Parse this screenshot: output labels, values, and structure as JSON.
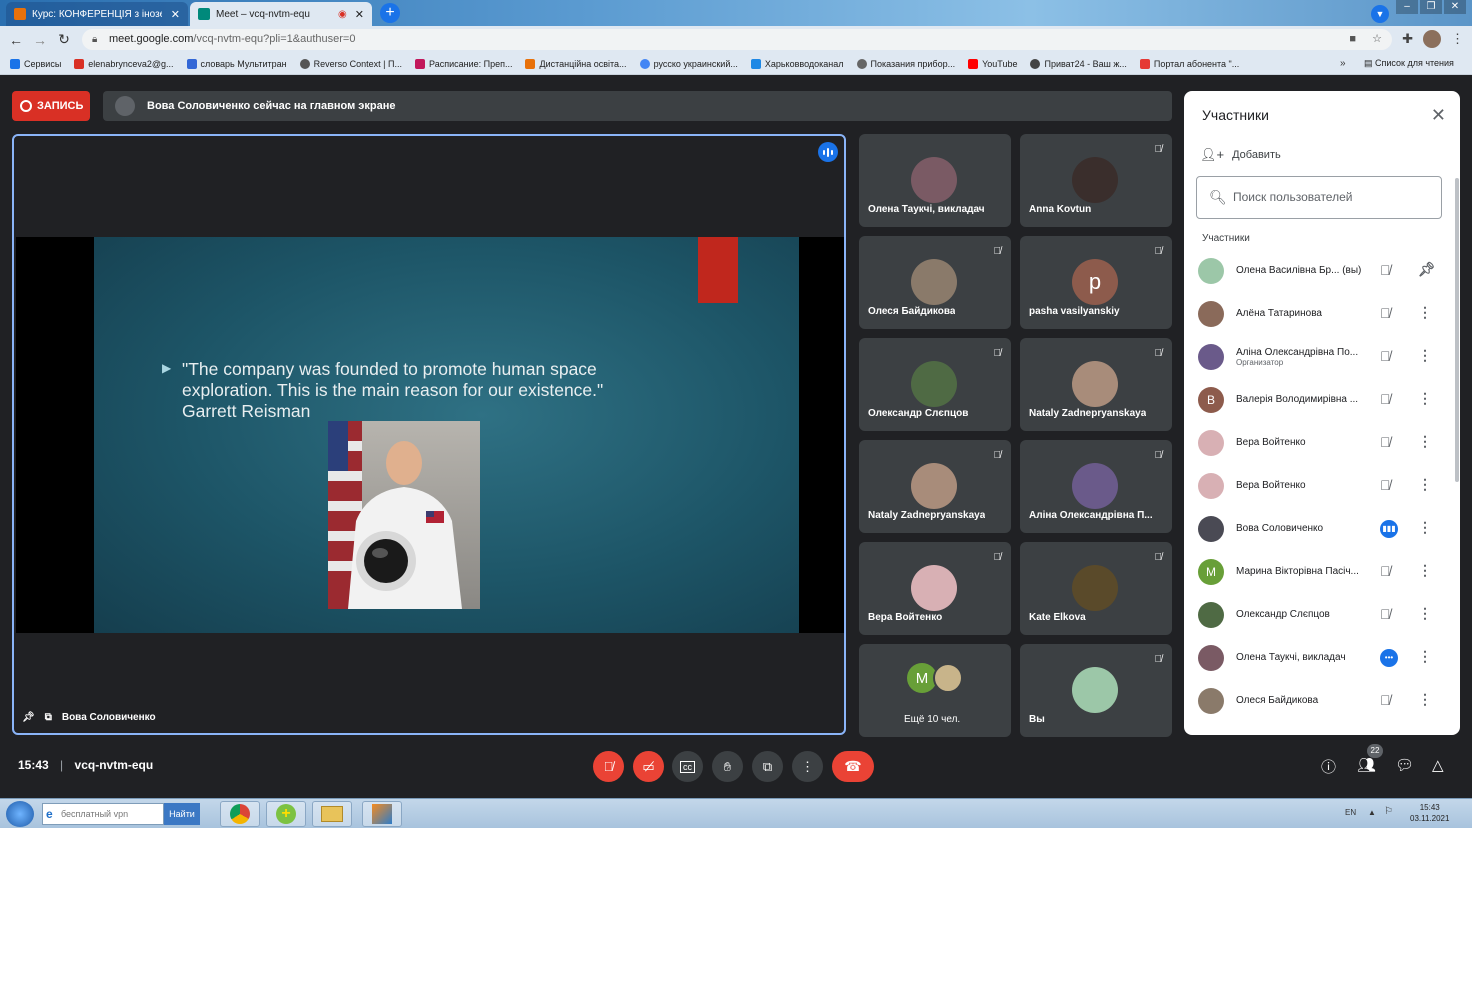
{
  "browser": {
    "tabs": [
      {
        "title": "Курс: КОНФЕРЕНЦІЯ з іноземно",
        "active": false
      },
      {
        "title": "Meet – vcq-nvtm-equ",
        "active": true
      }
    ],
    "new_tab": "+",
    "url_host": "meet.google.com",
    "url_path": "/vcq-nvtm-equ?pli=1&authuser=0",
    "bookmarks": [
      {
        "label": "Сервисы",
        "color": "#1a73e8"
      },
      {
        "label": "elenabrynceva2@g...",
        "color": "#d93025"
      },
      {
        "label": "словарь Мультитран",
        "color": "#3367d6"
      },
      {
        "label": "Reverso Context | П...",
        "color": "#555555"
      },
      {
        "label": "Расписание: Преп...",
        "color": "#c2185b"
      },
      {
        "label": "Дистанційна освіта...",
        "color": "#e8710a"
      },
      {
        "label": "русско украинский...",
        "color": "#4285f4"
      },
      {
        "label": "Харьковводоканал",
        "color": "#1e88e5"
      },
      {
        "label": "Показания прибор...",
        "color": "#666666"
      },
      {
        "label": "YouTube",
        "color": "#ff0000"
      },
      {
        "label": "Приват24 - Ваш ж...",
        "color": "#444444"
      },
      {
        "label": "Портал абонента \"...",
        "color": "#e53935"
      }
    ],
    "bookmarks_more": "»",
    "reading_list": "Список для чтения"
  },
  "meet": {
    "record_label": "ЗАПИСЬ",
    "banner_text": "Вова Соловиченко сейчас на главном экране",
    "slide": {
      "quote": "\"The company was founded to promote human space exploration. This is the main reason for our existence.\"",
      "author": "Garrett Reisman"
    },
    "presenter_name": "Вова Соловиченко",
    "tiles": [
      {
        "name": "Олена Таукчі, викладач",
        "muted": false,
        "avatar_color": "#7a5a64"
      },
      {
        "name": "Anna Kovtun",
        "muted": true,
        "avatar_color": "#3a2e2c"
      },
      {
        "name": "Олеся Байдикова",
        "muted": true,
        "avatar_color": "#8a7a6a"
      },
      {
        "name": "pasha vasilyanskiy",
        "muted": true,
        "avatar_letter": "p",
        "avatar_color": "#8d5b4c"
      },
      {
        "name": "Олександр Слєпцов",
        "muted": true,
        "avatar_color": "#4f6a44"
      },
      {
        "name": "Nataly Zadnepryanskaya",
        "muted": true,
        "avatar_color": "#a88c7a"
      },
      {
        "name": "Nataly Zadnepryanskaya",
        "muted": true,
        "avatar_color": "#a88c7a"
      },
      {
        "name": "Аліна Олександрівна П...",
        "muted": true,
        "avatar_color": "#6a5a8a"
      },
      {
        "name": "Вера Войтенко",
        "muted": true,
        "avatar_color": "#d8b0b4"
      },
      {
        "name": "Kate Elkova",
        "muted": true,
        "avatar_color": "#5a4a2a"
      },
      {
        "name": "Ещё 10 чел.",
        "muted": false,
        "avatar_letter": "M",
        "avatar_color": "#689f38"
      },
      {
        "name": "Вы",
        "muted": true,
        "avatar_color": "#9cc7a8"
      }
    ],
    "meeting_time": "15:43",
    "meeting_code": "vcq-nvtm-equ",
    "people_count": "22"
  },
  "panel": {
    "title": "Участники",
    "add_label": "Добавить",
    "search_placeholder": "Поиск пользователей",
    "section_label": "Участники",
    "participants": [
      {
        "name": "Олена Василівна Бр... (вы)",
        "role": "",
        "status": "muted",
        "action": "pin",
        "avatar_color": "#9cc7a8"
      },
      {
        "name": "Алёна Татаринова",
        "role": "",
        "status": "muted",
        "action": "more",
        "avatar_color": "#8a6a5a"
      },
      {
        "name": "Аліна Олександрівна По...",
        "role": "Организатор",
        "status": "muted",
        "action": "more",
        "avatar_color": "#6a5a8a"
      },
      {
        "name": "Валерія Володимирівна ...",
        "role": "",
        "status": "muted",
        "action": "more",
        "avatar_letter": "В",
        "avatar_color": "#8d5b4c"
      },
      {
        "name": "Вера Войтенко",
        "role": "",
        "status": "muted",
        "action": "more",
        "avatar_color": "#d8b0b4"
      },
      {
        "name": "Вера Войтенко",
        "role": "",
        "status": "muted",
        "action": "more",
        "avatar_color": "#d8b0b4"
      },
      {
        "name": "Вова Соловиченко",
        "role": "",
        "status": "speaking",
        "action": "more",
        "avatar_color": "#4a4a54"
      },
      {
        "name": "Марина Вікторівна Пасіч...",
        "role": "",
        "status": "muted",
        "action": "more",
        "avatar_letter": "M",
        "avatar_color": "#689f38"
      },
      {
        "name": "Олександр Слєпцов",
        "role": "",
        "status": "muted",
        "action": "more",
        "avatar_color": "#4f6a44"
      },
      {
        "name": "Олена Таукчі, викладач",
        "role": "",
        "status": "active",
        "action": "more",
        "avatar_color": "#7a5a64"
      },
      {
        "name": "Олеся Байдикова",
        "role": "",
        "status": "muted",
        "action": "more",
        "avatar_color": "#8a7a6a"
      }
    ]
  },
  "taskbar": {
    "search_placeholder": "бесплатный vpn",
    "search_button": "Найти",
    "lang": "EN",
    "time": "15:43",
    "date": "03.11.2021"
  }
}
